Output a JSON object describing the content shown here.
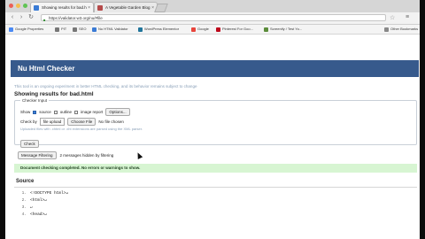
{
  "browser": {
    "tabs": [
      {
        "label": "Showing results for bad.h",
        "color": "#3a7bd5"
      },
      {
        "label": "A Vegetable Garden Blog",
        "color": "#b54a4a"
      }
    ],
    "address": "https://validator.w3.org/nu/#file",
    "bookmarks": [
      {
        "label": "Google Properties",
        "color": "#4a8af4"
      },
      {
        "label": "PIT",
        "color": "#777777"
      },
      {
        "label": "SEO",
        "color": "#777777"
      },
      {
        "label": "Nu HTML Validator",
        "color": "#3a7bd5"
      },
      {
        "label": "WordPress Elementor",
        "color": "#21759b"
      },
      {
        "label": "Google",
        "color": "#e8453c"
      },
      {
        "label": "Pinterest For Goo...",
        "color": "#bd081c"
      },
      {
        "label": "Screenify / Test Yo...",
        "color": "#5b8c3a"
      },
      {
        "label": "Other Bookmarks",
        "color": "#888888"
      }
    ]
  },
  "page": {
    "title": "Nu Html Checker",
    "tagline": "This tool is an ongoing experiment in better HTML checking, and its behavior remains subject to change",
    "results_title": "Showing results for bad.html",
    "checker_input": {
      "legend": "Checker Input",
      "show_label": "Show",
      "show_options": [
        {
          "label": "source",
          "checked": true
        },
        {
          "label": "outline",
          "checked": false
        },
        {
          "label": "image report",
          "checked": false
        }
      ],
      "options_button": "Options...",
      "check_by_label": "Check by",
      "check_by_value": "file upload",
      "choose_file_button": "Choose File",
      "no_file_text": "No file chosen",
      "hint": "Uploaded files with .xhtml or .xht extensions are parsed using the XML parser.",
      "check_button": "Check"
    },
    "message_filtering_button": "Message Filtering",
    "hidden_messages": "2 messages hidden by filtering",
    "success_message": "Document checking completed. No errors or warnings to show.",
    "source_title": "Source",
    "source_lines": [
      {
        "num": "1.",
        "text": "<!DOCTYPE html>↵"
      },
      {
        "num": "2.",
        "text": "<html>↵"
      },
      {
        "num": "3.",
        "text": "↵"
      },
      {
        "num": "4.",
        "text": "<head>↵"
      }
    ]
  },
  "colors": {
    "header_bg": "#375a8c",
    "success_bg": "#d7f5d2"
  }
}
